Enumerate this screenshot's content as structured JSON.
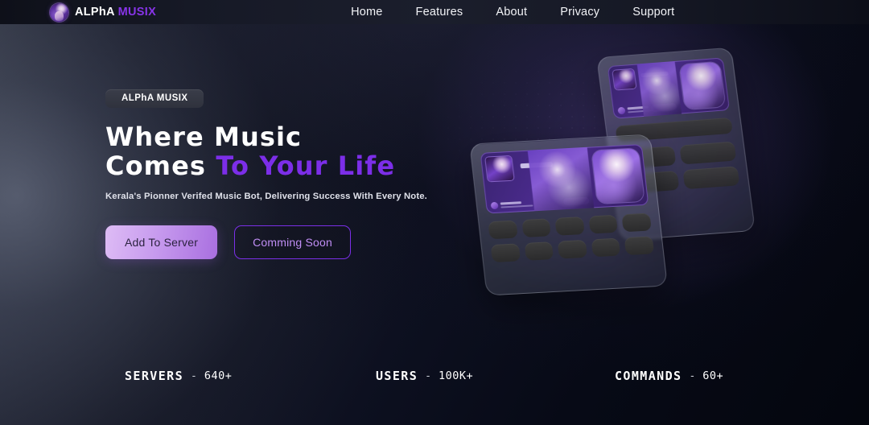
{
  "brand": {
    "name_primary": "ALPhA",
    "name_accent": "MUSIX",
    "logo_icon": "avatar-logo-icon"
  },
  "nav": {
    "items": [
      {
        "label": "Home"
      },
      {
        "label": "Features"
      },
      {
        "label": "About"
      },
      {
        "label": "Privacy"
      },
      {
        "label": "Support"
      }
    ]
  },
  "hero": {
    "badge": "ALPhA MUSIX",
    "heading_line1": "Where Music",
    "heading_line2_plain": "Comes ",
    "heading_line2_accent": "To Your Life",
    "subtitle": "Kerala's Pionner Verifed Music Bot, Delivering Success With Every Note.",
    "primary_button": "Add To Server",
    "secondary_button": "Comming Soon"
  },
  "stats": [
    {
      "key": "SERVERS",
      "dash": "-",
      "value": "640+"
    },
    {
      "key": "USERS",
      "dash": "-",
      "value": "100K+"
    },
    {
      "key": "COMMANDS",
      "dash": "-",
      "value": "60+"
    }
  ],
  "colors": {
    "accent_purple": "#7c2ee8",
    "brand_accent": "#8734e8",
    "ghost_button_text": "#c08ef5",
    "background_dark": "#05070f",
    "background_light_edge": "#3e4350"
  }
}
